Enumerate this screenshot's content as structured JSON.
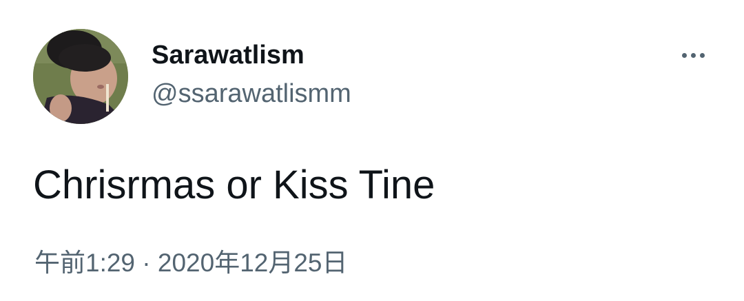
{
  "user": {
    "display_name": "Sarawatlism",
    "handle": "@ssarawatlismm"
  },
  "tweet": {
    "text": "Chrisrmas or Kiss Tine",
    "timestamp": "午前1:29 · 2020年12月25日"
  },
  "icons": {
    "more": "more-horizontal-icon",
    "avatar": "profile-photo"
  },
  "colors": {
    "primary_text": "#0f1419",
    "secondary_text": "#536471",
    "background": "#ffffff"
  }
}
